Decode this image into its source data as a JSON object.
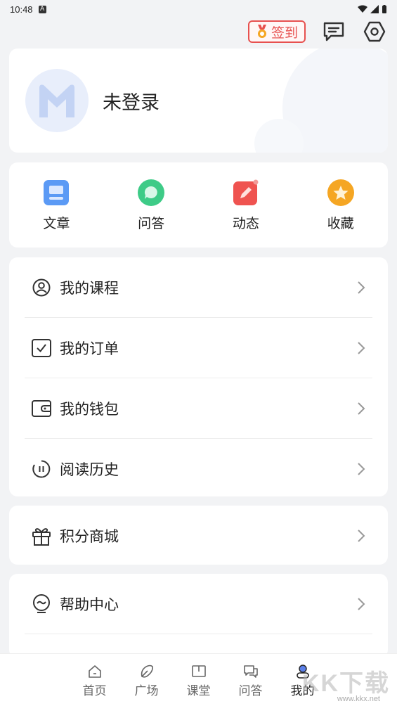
{
  "status_bar": {
    "time": "10:48",
    "badge": "A"
  },
  "header": {
    "signin_label": "签到"
  },
  "profile": {
    "login_text": "未登录"
  },
  "shortcuts": [
    {
      "label": "文章",
      "icon": "article-icon",
      "color": "#5b9af5"
    },
    {
      "label": "问答",
      "icon": "chat-bubble-icon",
      "color": "#3ecb87"
    },
    {
      "label": "动态",
      "icon": "pen-icon",
      "color": "#ef5350"
    },
    {
      "label": "收藏",
      "icon": "star-icon",
      "color": "#f5a623"
    }
  ],
  "menu": [
    {
      "label": "我的课程",
      "icon": "user-circle-icon"
    },
    {
      "label": "我的订单",
      "icon": "checkbox-icon"
    },
    {
      "label": "我的钱包",
      "icon": "wallet-icon"
    },
    {
      "label": "阅读历史",
      "icon": "history-icon"
    }
  ],
  "menu2": [
    {
      "label": "积分商城",
      "icon": "gift-icon"
    }
  ],
  "menu3": [
    {
      "label": "帮助中心",
      "icon": "help-icon"
    }
  ],
  "tabs": [
    {
      "label": "首页",
      "icon": "home-icon",
      "active": false
    },
    {
      "label": "广场",
      "icon": "plaza-icon",
      "active": false
    },
    {
      "label": "课堂",
      "icon": "book-icon",
      "active": false
    },
    {
      "label": "问答",
      "icon": "qa-icon",
      "active": false
    },
    {
      "label": "我的",
      "icon": "profile-icon",
      "active": true
    }
  ],
  "watermark": {
    "text": "KK下载",
    "url": "www.kkx.net"
  }
}
